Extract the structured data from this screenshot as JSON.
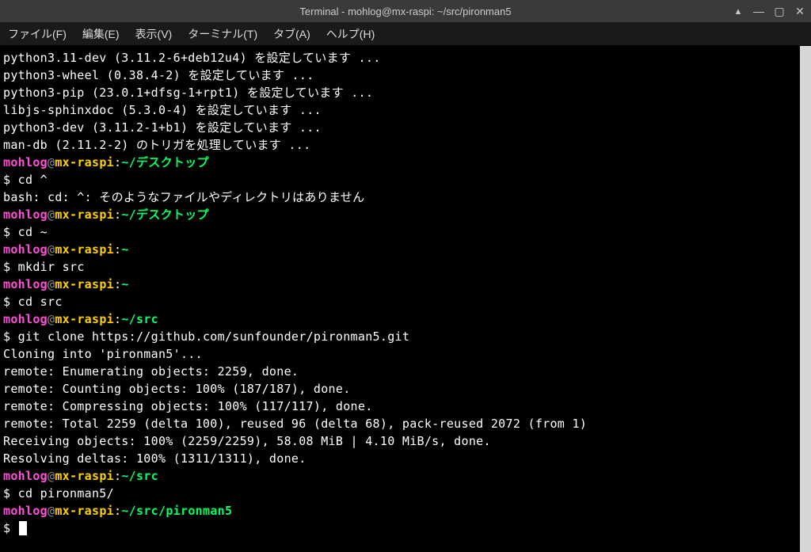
{
  "titlebar": {
    "title": "Terminal - mohlog@mx-raspi: ~/src/pironman5"
  },
  "menubar": {
    "file": "ファイル(F)",
    "edit": "編集(E)",
    "view": "表示(V)",
    "terminal": "ターミナル(T)",
    "tabs": "タブ(A)",
    "help": "ヘルプ(H)"
  },
  "prompt": {
    "user": "mohlog",
    "at": "@",
    "host": "mx-raspi",
    "colon": ":",
    "path_desktop": "~/デスクトップ",
    "path_home": "~",
    "path_src": "~/src",
    "path_pironman": "~/src/pironman5",
    "ps": "$ "
  },
  "lines": {
    "l1": "python3.11-dev (3.11.2-6+deb12u4) を設定しています ...",
    "l2": "python3-wheel (0.38.4-2) を設定しています ...",
    "l3": "python3-pip (23.0.1+dfsg-1+rpt1) を設定しています ...",
    "l4": "libjs-sphinxdoc (5.3.0-4) を設定しています ...",
    "l5": "python3-dev (3.11.2-1+b1) を設定しています ...",
    "l6": "man-db (2.11.2-2) のトリガを処理しています ...",
    "cmd_cd_caret": "cd ^",
    "err_cd": "bash: cd: ^: そのようなファイルやディレクトリはありません",
    "cmd_cd_home": "cd ~",
    "cmd_mkdir": "mkdir src",
    "cmd_cd_src": "cd src",
    "cmd_git": "git clone https://github.com/sunfounder/pironman5.git",
    "clone1": "Cloning into 'pironman5'...",
    "clone2": "remote: Enumerating objects: 2259, done.",
    "clone3": "remote: Counting objects: 100% (187/187), done.",
    "clone4": "remote: Compressing objects: 100% (117/117), done.",
    "clone5": "remote: Total 2259 (delta 100), reused 96 (delta 68), pack-reused 2072 (from 1)",
    "clone6": "Receiving objects: 100% (2259/2259), 58.08 MiB | 4.10 MiB/s, done.",
    "clone7": "Resolving deltas: 100% (1311/1311), done.",
    "cmd_cd_pironman": "cd pironman5/"
  }
}
